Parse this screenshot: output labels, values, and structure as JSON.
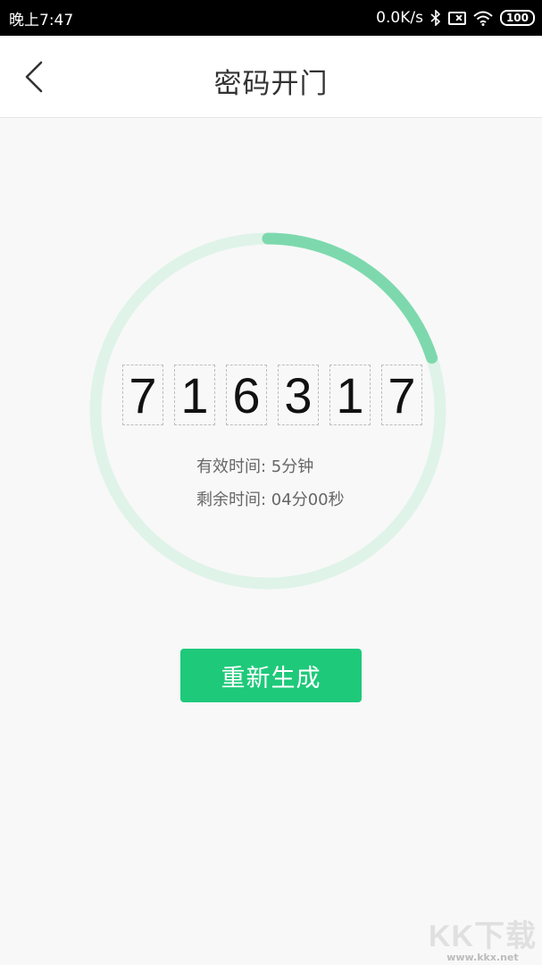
{
  "status_bar": {
    "time": "晚上7:47",
    "network_speed": "0.0K/s",
    "battery": "100",
    "icons": [
      "bluetooth-icon",
      "sim-no-service-icon",
      "wifi-icon",
      "battery-icon"
    ]
  },
  "nav": {
    "title": "密码开门",
    "back_icon": "chevron-left-icon"
  },
  "code": {
    "digits": [
      "7",
      "1",
      "6",
      "3",
      "1",
      "7"
    ]
  },
  "timer": {
    "progress_fraction": 0.2,
    "track_color": "#dff3e9",
    "progress_color": "#7dd9ad"
  },
  "info": {
    "valid_time": "有效时间: 5分钟",
    "remaining_time": "剩余时间: 04分00秒"
  },
  "actions": {
    "regenerate_label": "重新生成",
    "accent_color": "#1ec97a"
  },
  "watermark": {
    "logo": "KK下载",
    "url": "www.kkx.net"
  }
}
